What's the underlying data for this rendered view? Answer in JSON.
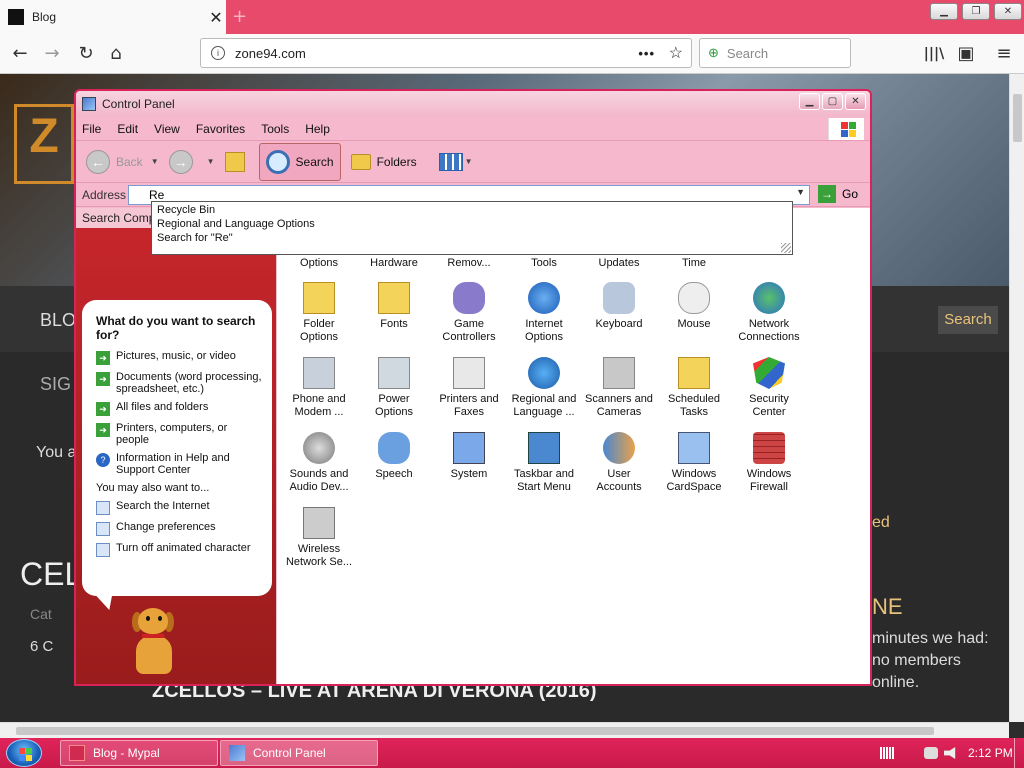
{
  "browser": {
    "tab_title": "Blog",
    "tab_close": "✕",
    "new_tab": "+",
    "url": "zone94.com",
    "search_placeholder": "Search",
    "back": "←",
    "forward": "→",
    "reload": "↻",
    "home": "⌂",
    "more": "•••",
    "bookmark_star": "☆",
    "library": "|||\\",
    "sidebar": "▣",
    "menu": "≡",
    "minimize": "▁",
    "restore": "❐",
    "close": "✕"
  },
  "website": {
    "logo_letter": "Z",
    "menu_blog": "BLO",
    "menu_sign": "SIG",
    "you_text": "You a",
    "celi_text": "CELI",
    "cat_text": "Cat",
    "count_text": "6 C",
    "red_text": "ed",
    "ne_text": "NE",
    "minutes_text": "minutes we had:",
    "members_text": "no members",
    "online_text": "online.",
    "search_btn": "Search",
    "headline": "ZCELLOS – LIVE AT ARENA DI VERONA (2016)"
  },
  "control_panel": {
    "title": "Control Panel",
    "menus": [
      "File",
      "Edit",
      "View",
      "Favorites",
      "Tools",
      "Help"
    ],
    "toolbar": {
      "back": "Back",
      "search": "Search",
      "folders": "Folders"
    },
    "address_label": "Address",
    "address_value": "Re",
    "go_label": "Go",
    "left_header": "Search Comp",
    "autocomplete": [
      "Recycle Bin",
      "Regional and Language Options",
      "Search for \"Re\""
    ],
    "search_companion": {
      "question": "What do you want to search for?",
      "options": [
        "Pictures, music, or video",
        "Documents (word processing, spreadsheet, etc.)",
        "All files and folders",
        "Printers, computers, or people",
        "Information in Help and Support Center"
      ],
      "also_label": "You may also want to...",
      "also_options": [
        "Search the Internet",
        "Change preferences",
        "Turn off animated character"
      ]
    },
    "items_row0": [
      "Options",
      "Hardware",
      "Remov...",
      "Tools",
      "Updates",
      "Time"
    ],
    "items": [
      [
        "Folder",
        "Options"
      ],
      [
        "Fonts",
        ""
      ],
      [
        "Game",
        "Controllers"
      ],
      [
        "Internet",
        "Options"
      ],
      [
        "Keyboard",
        ""
      ],
      [
        "Mouse",
        ""
      ],
      [
        "Network",
        "Connections"
      ],
      [
        "Phone and",
        "Modem ..."
      ],
      [
        "Power",
        "Options"
      ],
      [
        "Printers and",
        "Faxes"
      ],
      [
        "Regional and",
        "Language ..."
      ],
      [
        "Scanners and",
        "Cameras"
      ],
      [
        "Scheduled",
        "Tasks"
      ],
      [
        "Security",
        "Center"
      ],
      [
        "Sounds and",
        "Audio Dev..."
      ],
      [
        "Speech",
        ""
      ],
      [
        "System",
        ""
      ],
      [
        "Taskbar and",
        "Start Menu"
      ],
      [
        "User",
        "Accounts"
      ],
      [
        "Windows",
        "CardSpace"
      ],
      [
        "Windows",
        "Firewall"
      ],
      [
        "Wireless",
        "Network Se..."
      ]
    ]
  },
  "taskbar": {
    "buttons": [
      "Blog - Mypal",
      "Control Panel"
    ],
    "clock": "2:12 PM"
  }
}
